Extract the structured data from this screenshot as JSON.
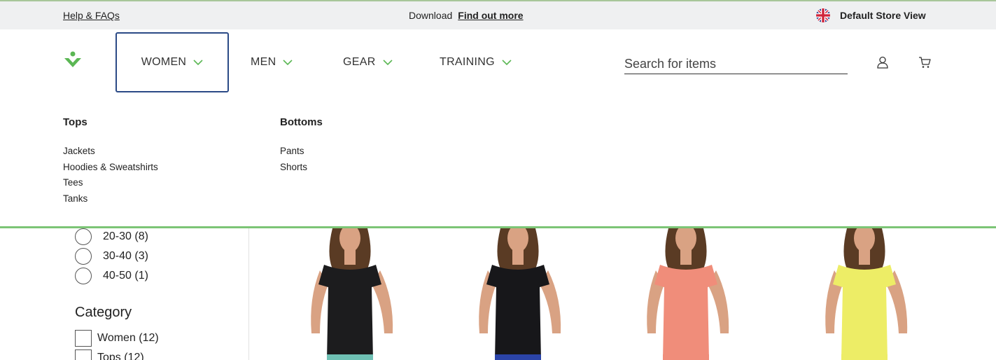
{
  "topbar": {
    "help_label": "Help & FAQs",
    "promo_text": "Download",
    "promo_link": "Find out more",
    "store_label": "Default Store View"
  },
  "nav": {
    "items": [
      {
        "label": "WOMEN"
      },
      {
        "label": "MEN"
      },
      {
        "label": "GEAR"
      },
      {
        "label": "TRAINING"
      }
    ]
  },
  "search": {
    "placeholder": "Search for items"
  },
  "megamenu": {
    "columns": [
      {
        "title": "Tops",
        "links": [
          "Jackets",
          "Hoodies & Sweatshirts",
          "Tees",
          "Tanks"
        ]
      },
      {
        "title": "Bottoms",
        "links": [
          "Pants",
          "Shorts"
        ]
      }
    ]
  },
  "filters": {
    "price_options": [
      "20-30 (8)",
      "30-40 (3)",
      "40-50 (1)"
    ],
    "category_title": "Category",
    "category_options": [
      "Women (12)",
      "Tops (12)"
    ]
  },
  "products": [
    {
      "shirt_color": "#1c1c1e",
      "shorts_color": "#6fc0b4"
    },
    {
      "shirt_color": "#17171a",
      "shorts_color": "#2b44a8"
    },
    {
      "shirt_color": "#f08d7a",
      "shorts_color": "#f08d7a"
    },
    {
      "shirt_color": "#eded66",
      "shorts_color": "#eded66"
    }
  ],
  "colors": {
    "accent_green": "#5bb754",
    "active_border": "#2b4a86",
    "divider_green": "#7cc576"
  },
  "icons": [
    "flag-uk-icon",
    "logo-icon",
    "chevron-down-icon",
    "user-icon",
    "cart-icon"
  ]
}
